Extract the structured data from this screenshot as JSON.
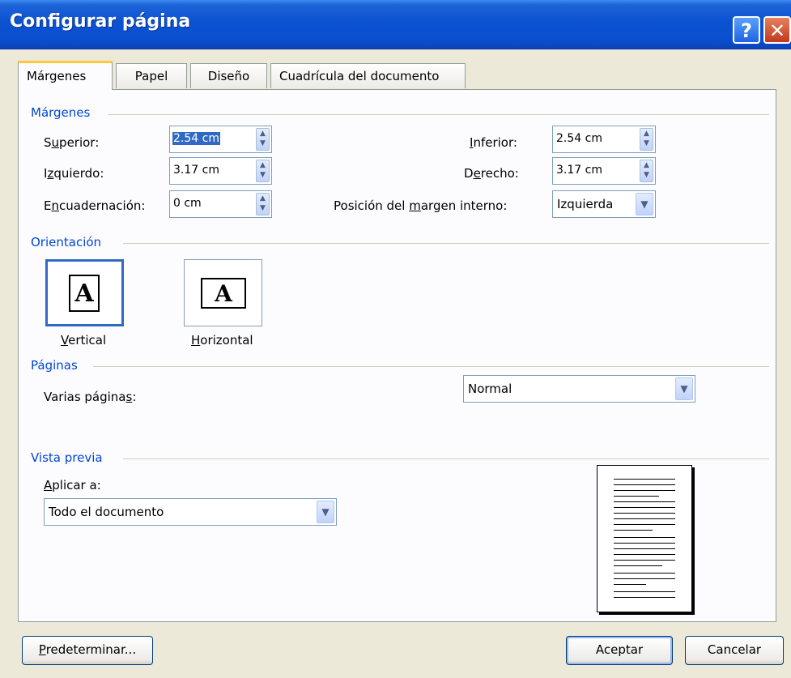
{
  "window": {
    "title": "Configurar página",
    "help": "?",
    "close": "✕"
  },
  "tabs": [
    "Márgenes",
    "Papel",
    "Diseño",
    "Cuadrícula del documento"
  ],
  "margins": {
    "group": "Márgenes",
    "top": {
      "label_pre": "S",
      "label_u": "u",
      "label_post": "perior:",
      "value": "2.54 cm"
    },
    "left": {
      "label_pre": "I",
      "label_u": "z",
      "label_post": "quierdo:",
      "value": "3.17 cm"
    },
    "gutter": {
      "label_pre": "E",
      "label_u": "n",
      "label_post": "cuadernación:",
      "value": "0 cm"
    },
    "bottom": {
      "label_pre": "",
      "label_u": "I",
      "label_post": "nferior:",
      "value": "2.54 cm"
    },
    "right": {
      "label_pre": "D",
      "label_u": "e",
      "label_post": "recho:",
      "value": "3.17 cm"
    },
    "gutter_pos": {
      "label_pre": "Posición del ",
      "label_u": "m",
      "label_post": "argen interno:",
      "value": "Izquierda"
    }
  },
  "orientation": {
    "group": "Orientación",
    "portrait": {
      "label_u": "V",
      "label_post": "ertical",
      "glyph": "A"
    },
    "landscape": {
      "label_u": "H",
      "label_post": "orizontal",
      "glyph": "A"
    }
  },
  "pages": {
    "group": "Páginas",
    "multiple": {
      "label_pre": "Varias página",
      "label_u": "s",
      "label_post": ":",
      "value": "Normal"
    }
  },
  "preview": {
    "group": "Vista previa",
    "apply_to": {
      "label_u": "A",
      "label_post": "plicar a:",
      "value": "Todo el documento"
    }
  },
  "buttons": {
    "default": {
      "label_u": "P",
      "label_post": "redeterminar..."
    },
    "ok": "Aceptar",
    "cancel": "Cancelar"
  }
}
